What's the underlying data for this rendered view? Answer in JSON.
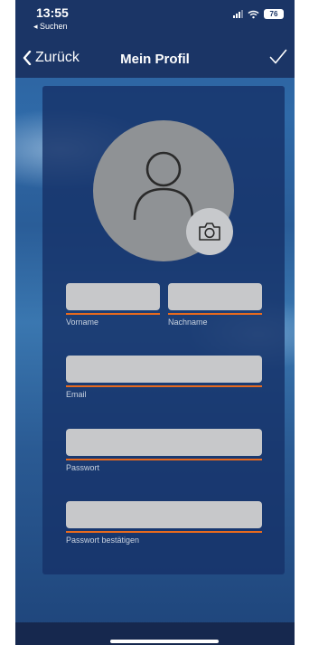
{
  "status_bar": {
    "time": "13:55",
    "back_app": "◂ Suchen",
    "battery": "76"
  },
  "nav": {
    "back_label": "Zurück",
    "title": "Mein Profil"
  },
  "form": {
    "first_name": {
      "caption": "Vorname",
      "value": ""
    },
    "last_name": {
      "caption": "Nachname",
      "value": ""
    },
    "email": {
      "caption": "Email",
      "value": ""
    },
    "password": {
      "caption": "Passwort",
      "value": ""
    },
    "password_confirm": {
      "caption": "Passwort bestätigen",
      "value": ""
    }
  },
  "colors": {
    "accent_underline": "#e86a1e",
    "nav_bar": "#1b3566",
    "card": "#163269",
    "field": "#c7c8ca"
  },
  "icons": [
    "chevron-left-icon",
    "checkmark-icon",
    "user-icon",
    "camera-icon",
    "wifi-icon",
    "signal-icon",
    "battery-icon"
  ]
}
